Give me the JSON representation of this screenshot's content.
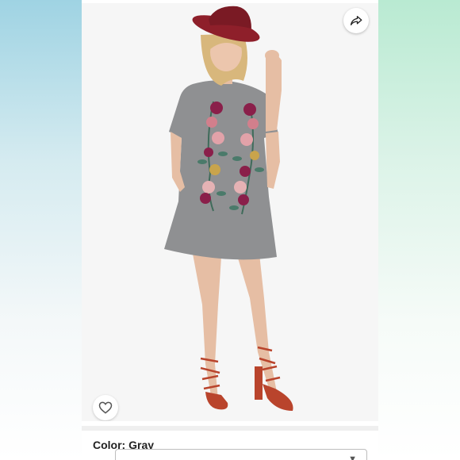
{
  "listing": {
    "color_label": "Color: Gray"
  },
  "photo": {
    "icon_share": "share-arrow-icon",
    "icon_like": "heart-outline-icon"
  },
  "colors": {
    "hat": "#8e1f2a",
    "dress": "#8f9092",
    "sandal": "#b9442c",
    "skin": "#e9c2a8",
    "hair": "#d8b77c"
  }
}
